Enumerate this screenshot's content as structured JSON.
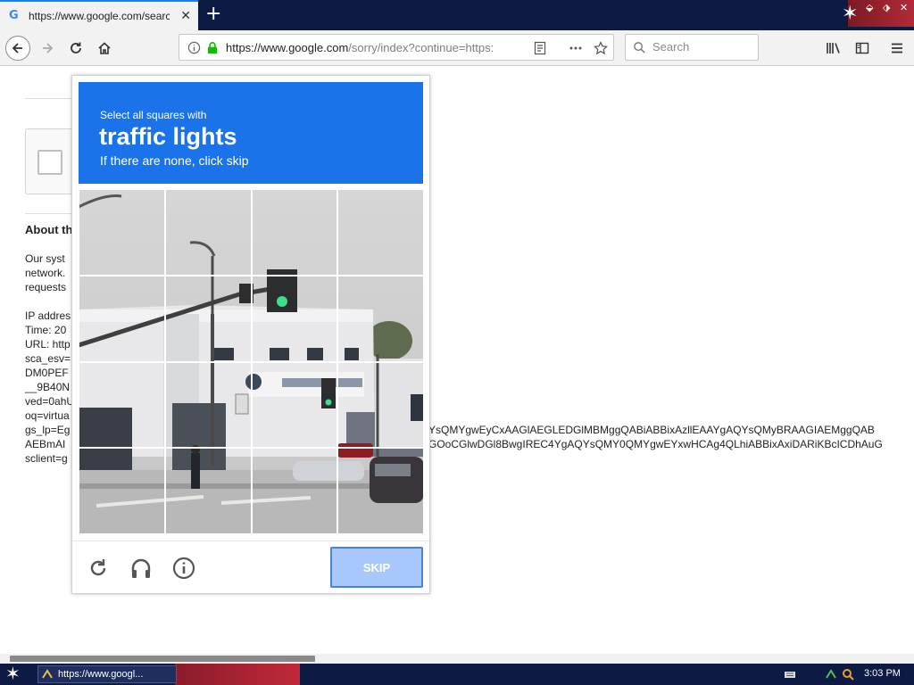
{
  "browser": {
    "tab_title": "https://www.google.com/search?",
    "tab_favicon": "G",
    "new_tab_label": "+",
    "url_host": "https://www.google.com",
    "url_path": "/sorry/index?continue=https:",
    "search_placeholder": "Search"
  },
  "page": {
    "about_heading": "About th",
    "lines_top": [
      "Our syst",
      "network.",
      "requests"
    ],
    "lines_mid": [
      "IP addres",
      "Time: 20",
      "URL: http",
      "sca_esv=",
      "DM0PEF",
      "__9B40N",
      "ved=0ahU",
      "oq=virtua",
      "gs_lp=Eg",
      "AEBmAI",
      "sclient=g"
    ],
    "long_line_1": "YsQMYgwEyCxAAGlAEGLEDGlMBMggQABiABBixAzllEAAYgAQYsQMyBRAAGIAEMggQAB",
    "long_line_2": "GOoCGlwDGl8BwgIREC4YgAQYsQMY0QMYgwEYxwHCAg4QLhiABBixAxiDARiKBcICDhAuG"
  },
  "challenge": {
    "instruction_small": "Select all squares with",
    "instruction_target": "traffic lights",
    "instruction_sub": "If there are none, click skip",
    "skip_label": "SKIP",
    "header_color": "#1a73e8",
    "footer_icons": [
      "reload-icon",
      "audio-headphones-icon",
      "info-icon"
    ]
  },
  "taskbar": {
    "task_label": "https://www.googl...",
    "clock": "3:03 PM"
  }
}
